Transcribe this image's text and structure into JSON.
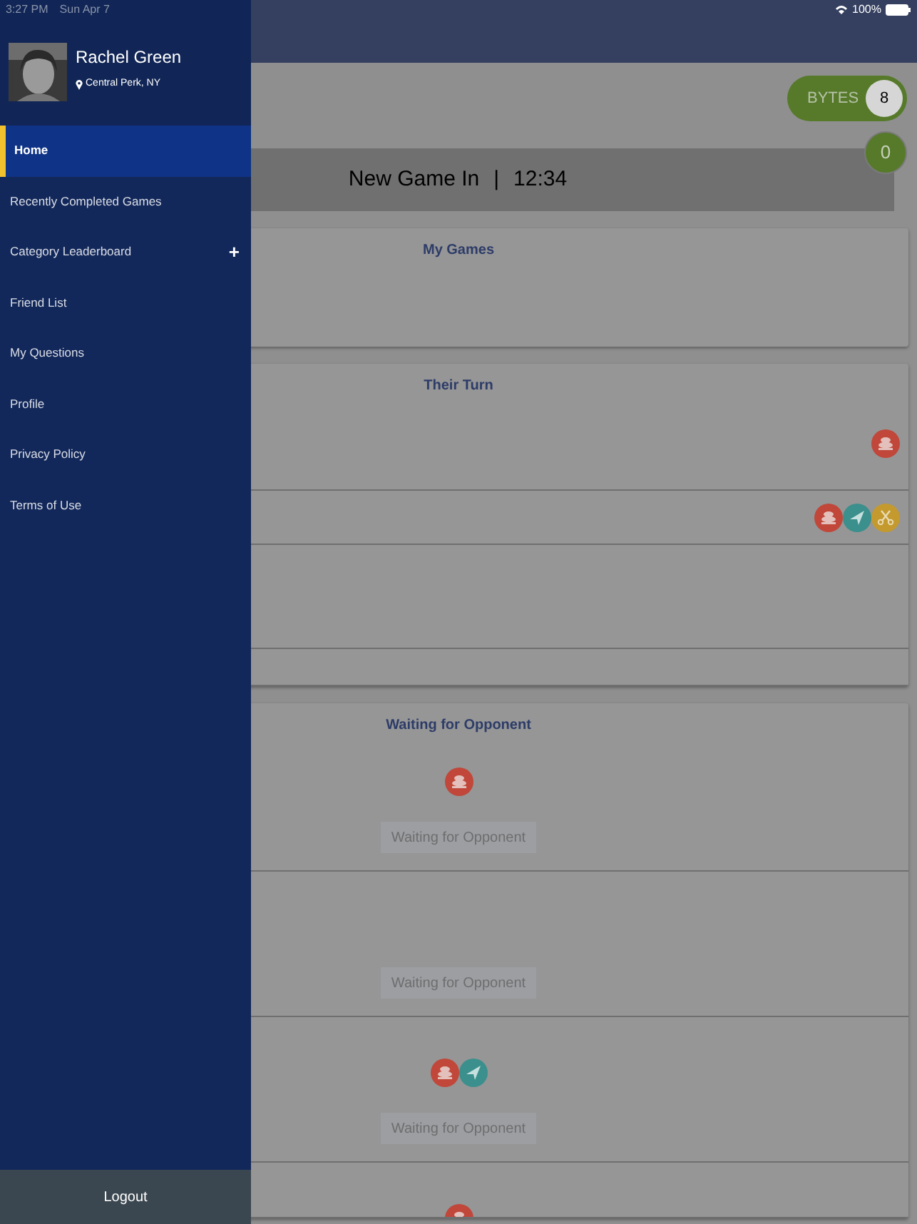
{
  "status_bar": {
    "time": "3:27 PM",
    "date": "Sun Apr 7",
    "battery": "100%"
  },
  "drawer": {
    "user": {
      "name": "Rachel Green",
      "location": "Central Perk, NY"
    },
    "items": [
      {
        "label": "Home",
        "selected": true
      },
      {
        "label": "Recently Completed Games",
        "selected": false
      },
      {
        "label": "Category Leaderboard",
        "selected": false,
        "expander": "+"
      },
      {
        "label": "Friend List",
        "selected": false
      },
      {
        "label": "My Questions",
        "selected": false
      },
      {
        "label": "Profile",
        "selected": false
      },
      {
        "label": "Privacy Policy",
        "selected": false
      },
      {
        "label": "Terms of Use",
        "selected": false
      }
    ],
    "logout": "Logout"
  },
  "bytes": {
    "label": "BYTES",
    "count": "8"
  },
  "score": "0",
  "new_game": {
    "label": "New Game In",
    "separator": "|",
    "time": "12:34"
  },
  "sections": [
    {
      "title": "My Games",
      "kind": "empty"
    },
    {
      "title": "Their Turn",
      "kind": "their_turn",
      "rows": [
        {
          "kind": "icons",
          "icons": [
            {
              "kind": "stack",
              "color": "#c0473a"
            }
          ]
        },
        {
          "kind": "icons",
          "icons": [
            {
              "kind": "stack",
              "color": "#c0473a"
            },
            {
              "kind": "plane",
              "color": "#3b8f8c"
            },
            {
              "kind": "scissors",
              "color": "#c49a2e"
            }
          ]
        },
        {
          "kind": "blank"
        },
        {
          "kind": "blank"
        }
      ]
    },
    {
      "title": "Waiting for Opponent",
      "kind": "waiting",
      "rows": [
        {
          "icons": [
            {
              "kind": "stack",
              "color": "#c0473a"
            }
          ],
          "button": "Waiting for Opponent"
        },
        {
          "button": "Waiting for Opponent"
        },
        {
          "icons": [
            {
              "kind": "stack",
              "color": "#c0473a"
            },
            {
              "kind": "plane",
              "color": "#3b8f8c"
            }
          ],
          "button": "Waiting for Opponent"
        },
        {
          "icons": [
            {
              "kind": "stack",
              "color": "#c0473a"
            }
          ]
        }
      ]
    }
  ]
}
